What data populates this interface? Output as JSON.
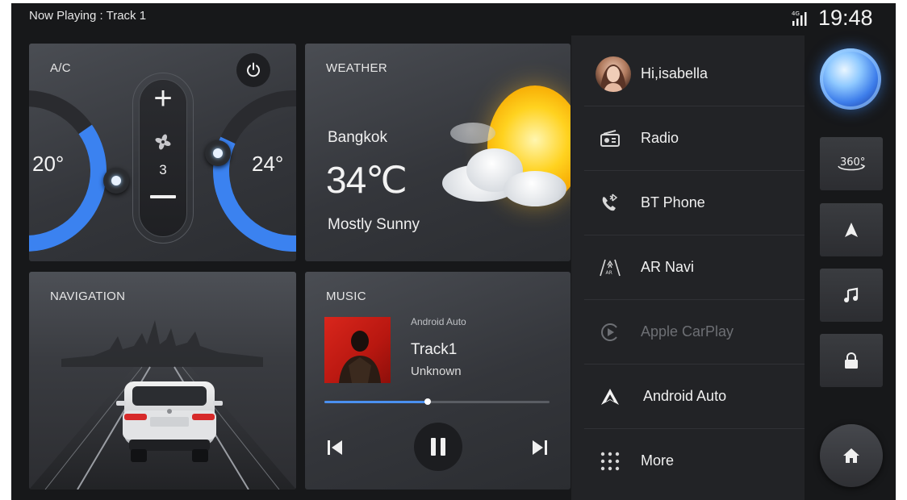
{
  "status_bar": {
    "now_playing": "Now Playing : Track 1",
    "network": "4G",
    "clock": "19:48"
  },
  "ac": {
    "title": "A/C",
    "left_temp": "20°",
    "right_temp": "24°",
    "fan_level": "3",
    "accent_color": "#3b82f0"
  },
  "weather": {
    "title": "WEATHER",
    "city": "Bangkok",
    "temperature": "34℃",
    "condition": "Mostly Sunny"
  },
  "navigation": {
    "title": "NAVIGATION"
  },
  "music": {
    "title": "MUSIC",
    "source": "Android Auto",
    "track": "Track1",
    "artist": "Unknown",
    "progress": 0.46
  },
  "apps": [
    {
      "label": "Hi,isabella",
      "icon": "user-avatar",
      "enabled": true
    },
    {
      "label": "Radio",
      "icon": "radio-icon",
      "enabled": true
    },
    {
      "label": "BT Phone",
      "icon": "bluetooth-phone-icon",
      "enabled": true
    },
    {
      "label": "AR Navi",
      "icon": "ar-navi-icon",
      "enabled": true
    },
    {
      "label": "Apple CarPlay",
      "icon": "carplay-icon",
      "enabled": false
    },
    {
      "label": "Android Auto",
      "icon": "android-auto-icon",
      "enabled": true
    },
    {
      "label": "More",
      "icon": "grid-dots-icon",
      "enabled": true
    }
  ],
  "right_rail": {
    "view_360_label": "360°",
    "buttons": [
      "assistant-orb",
      "360-view",
      "navigation-arrow",
      "music-note",
      "lock",
      "home"
    ]
  }
}
